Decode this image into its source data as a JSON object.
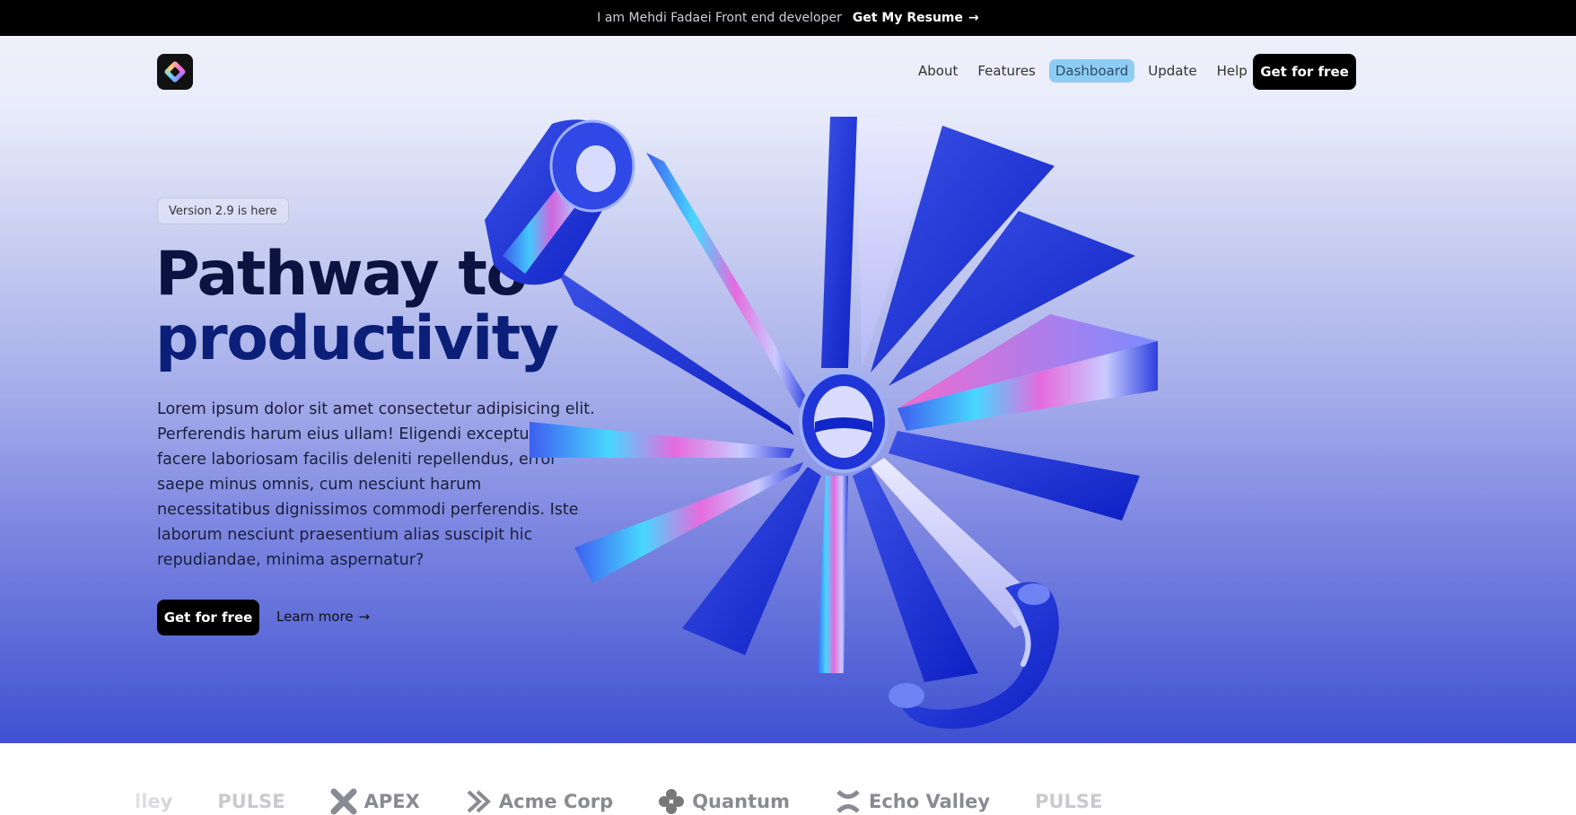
{
  "topbar": {
    "intro": "I am Mehdi Fadaei Front end developer",
    "resume_label": "Get My Resume",
    "arrow": "→"
  },
  "nav": {
    "items": [
      {
        "label": "About"
      },
      {
        "label": "Features"
      },
      {
        "label": "Dashboard",
        "active": true
      },
      {
        "label": "Update"
      },
      {
        "label": "Help"
      }
    ],
    "cta_label": "Get for free"
  },
  "hero": {
    "badge": "Version 2.9 is here",
    "title_line1": "Pathway to",
    "title_line2": "productivity",
    "description": "Lorem ipsum dolor sit amet consectetur adipisicing elit. Perferendis harum eius ullam! Eligendi excepturi, facere laboriosam facilis deleniti repellendus, error saepe minus omnis, cum nesciunt harum necessitatibus dignissimos commodi perferendis. Iste laborum nesciunt praesentium alias suscipit hic repudiandae, minima aspernatur?",
    "cta_label": "Get for free",
    "learn_label": "Learn more",
    "learn_arrow": "→"
  },
  "logos": {
    "items": [
      "lley",
      "PULSE",
      "APEX",
      "Acme Corp",
      "Quantum",
      "Echo Valley",
      "PULSE"
    ]
  },
  "colors": {
    "accent_active": "#8ecdf3",
    "hero_bottom": "#3f51d1",
    "headline_dark": "#0c1340",
    "headline_blue": "#0b1f78"
  }
}
